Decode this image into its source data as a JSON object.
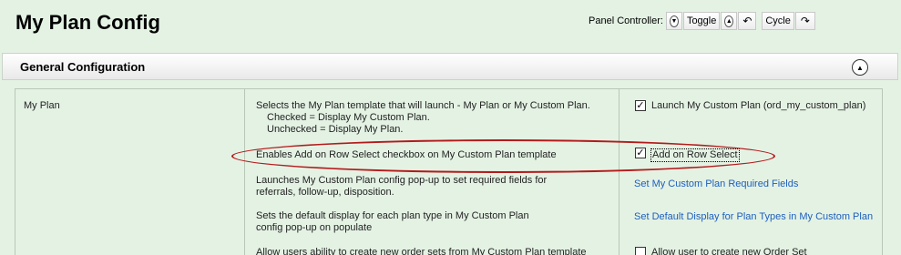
{
  "page": {
    "title": "My Plan Config"
  },
  "panel_controller": {
    "label": "Panel Controller:",
    "toggle_label": "Toggle",
    "cycle_label": "Cycle"
  },
  "section": {
    "title": "General Configuration"
  },
  "rows": [
    {
      "name": "My Plan",
      "description": [
        "Selects the My Plan template that will launch - My Plan or My Custom Plan.",
        "Checked = Display My Custom Plan.",
        "Unchecked = Display My Plan."
      ],
      "control": {
        "type": "checkbox",
        "checked": true,
        "label": "Launch My Custom Plan  (ord_my_custom_plan)"
      }
    },
    {
      "description": [
        "Enables Add on Row Select checkbox on My Custom Plan template"
      ],
      "control": {
        "type": "checkbox",
        "checked": true,
        "label": "Add on Row Select"
      }
    },
    {
      "description": [
        "Launches My Custom Plan config pop-up to set required fields for",
        "referrals, follow-up, disposition."
      ],
      "control": {
        "type": "link",
        "label": "Set My Custom Plan Required Fields"
      }
    },
    {
      "description": [
        "Sets the default display for each plan type in My Custom Plan",
        "config pop-up on populate"
      ],
      "control": {
        "type": "link",
        "label": "Set Default Display for Plan Types in My Custom Plan"
      }
    },
    {
      "description": [
        "Allow users ability to create new order sets from My Custom Plan template"
      ],
      "control": {
        "type": "checkbox",
        "checked": false,
        "label": "Allow user to create new Order Set"
      }
    }
  ],
  "colors": {
    "background": "#e4f2e4",
    "link": "#1c5fbf",
    "highlight_ring": "#b31b1b"
  }
}
